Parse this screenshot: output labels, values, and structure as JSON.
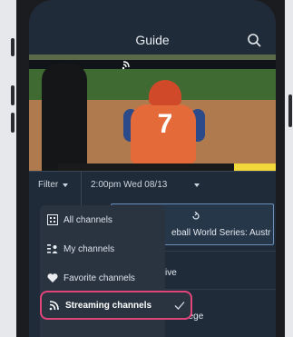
{
  "guide": {
    "title": "Guide"
  },
  "filter": {
    "label": "Filter",
    "time": "2:00pm Wed 08/13"
  },
  "programs": [
    {
      "title": "eball World Series: Austr"
    },
    {
      "title": "ive"
    },
    {
      "title": "n College"
    }
  ],
  "menu": {
    "items": [
      {
        "label": "All channels",
        "icon": "grid-icon"
      },
      {
        "label": "My channels",
        "icon": "list-user-icon"
      },
      {
        "label": "Favorite channels",
        "icon": "heart-icon"
      },
      {
        "label": "Streaming channels",
        "icon": "streaming-icon",
        "selected": true
      }
    ]
  },
  "colors": {
    "accent": "#e0457a",
    "panel": "#2a3441",
    "screen_bg": "#1f2b39"
  },
  "video": {
    "jersey_number": "7"
  }
}
